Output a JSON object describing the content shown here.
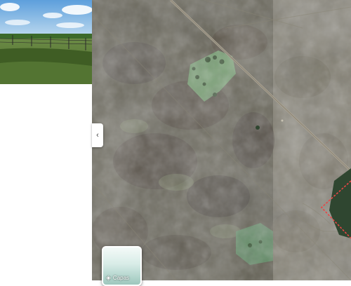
{
  "side_panel": {
    "collapse_icon": "chevron-left-icon",
    "collapse_glyph": "‹"
  },
  "layers": {
    "label": "Capas",
    "icon": "layers-icon",
    "icon_glyph": "◈"
  },
  "map": {
    "map_type": "satellite",
    "highlight_color": "#e84545"
  }
}
